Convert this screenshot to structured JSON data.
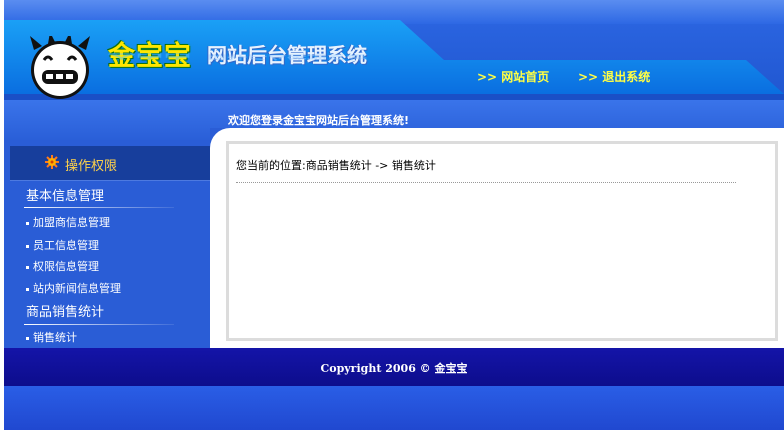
{
  "header": {
    "brand": "金宝宝",
    "system_title": "网站后台管理系统",
    "nav": [
      {
        "label": ">> 网站首页"
      },
      {
        "label": ">> 退出系统"
      }
    ]
  },
  "welcome": "欢迎您登录金宝宝网站后台管理系统!",
  "sidebar": {
    "section_title": "操作权限",
    "groups": [
      {
        "title": "基本信息管理",
        "items": [
          "加盟商信息管理",
          "员工信息管理",
          "权限信息管理",
          "站内新闻信息管理"
        ]
      },
      {
        "title": "商品销售统计",
        "items": [
          "销售统计"
        ]
      }
    ]
  },
  "content": {
    "location": "您当前的位置:商品销售统计 -> 销售统计"
  },
  "footer": {
    "copyright": "Copyright 2006 © 金宝宝"
  },
  "colors": {
    "header_blue": "#2d68e4",
    "banner_cyan": "#1aa0f6",
    "sidebar_blue": "#2a5dd6",
    "footer_navy": "#1414a8",
    "nav_yellow": "#ffff44",
    "perm_gold": "#ffd24a"
  }
}
